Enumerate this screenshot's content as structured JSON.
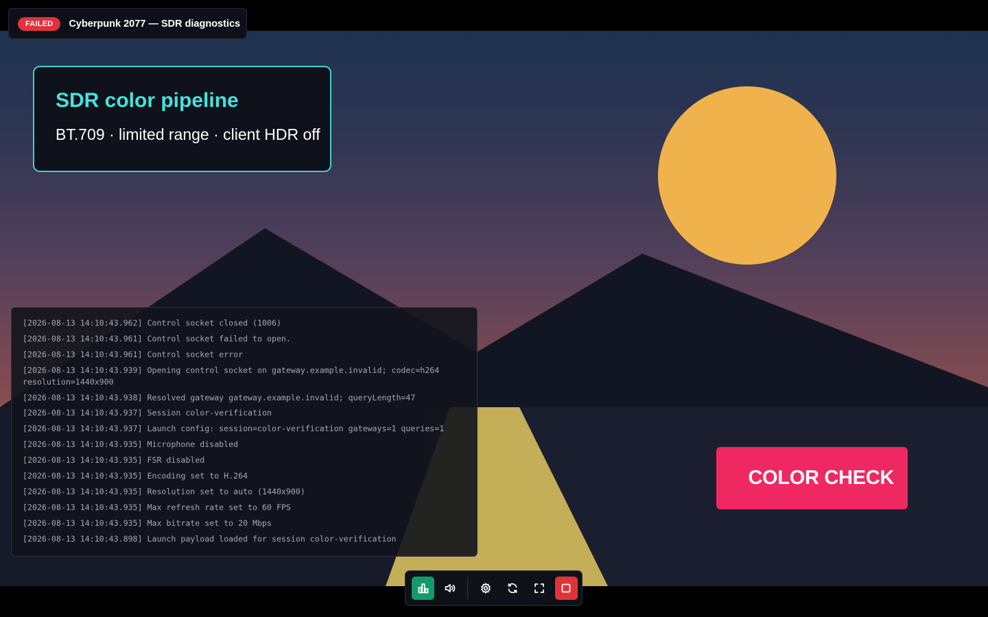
{
  "header": {
    "status_badge": "FAILED",
    "title": "Cyberpunk 2077 — SDR diagnostics"
  },
  "pipeline_card": {
    "heading": "SDR color pipeline",
    "details": "BT.709 · limited range · client HDR off"
  },
  "color_check_label": "COLOR CHECK",
  "log_lines": [
    "[2026-08-13 14:10:43.962] Control socket closed (1006)",
    "[2026-08-13 14:10:43.961] Control socket failed to open.",
    "[2026-08-13 14:10:43.961] Control socket error",
    "[2026-08-13 14:10:43.939] Opening control socket on gateway.example.invalid; codec=h264 resolution=1440x900",
    "[2026-08-13 14:10:43.938] Resolved gateway gateway.example.invalid; queryLength=47",
    "[2026-08-13 14:10:43.937] Session color-verification",
    "[2026-08-13 14:10:43.937] Launch config: session=color-verification gateways=1 queries=1",
    "[2026-08-13 14:10:43.935] Microphone disabled",
    "[2026-08-13 14:10:43.935] FSR disabled",
    "[2026-08-13 14:10:43.935] Encoding set to H.264",
    "[2026-08-13 14:10:43.935] Resolution set to auto (1440x900)",
    "[2026-08-13 14:10:43.935] Max refresh rate set to 60 FPS",
    "[2026-08-13 14:10:43.935] Max bitrate set to 20 Mbps",
    "[2026-08-13 14:10:43.898] Launch payload loaded for session color-verification"
  ],
  "dock": {
    "buttons": [
      "stats-icon",
      "volume-icon",
      "settings-icon",
      "refresh-icon",
      "fullscreen-icon",
      "stop-icon"
    ]
  },
  "colors": {
    "badge": "#e0313d",
    "accent_teal": "#45e2dc",
    "color_check": "#f02861",
    "sun": "#f0b24c",
    "road": "#c4ae58",
    "stats_button": "#129b6a",
    "stop_button": "#e03437"
  }
}
